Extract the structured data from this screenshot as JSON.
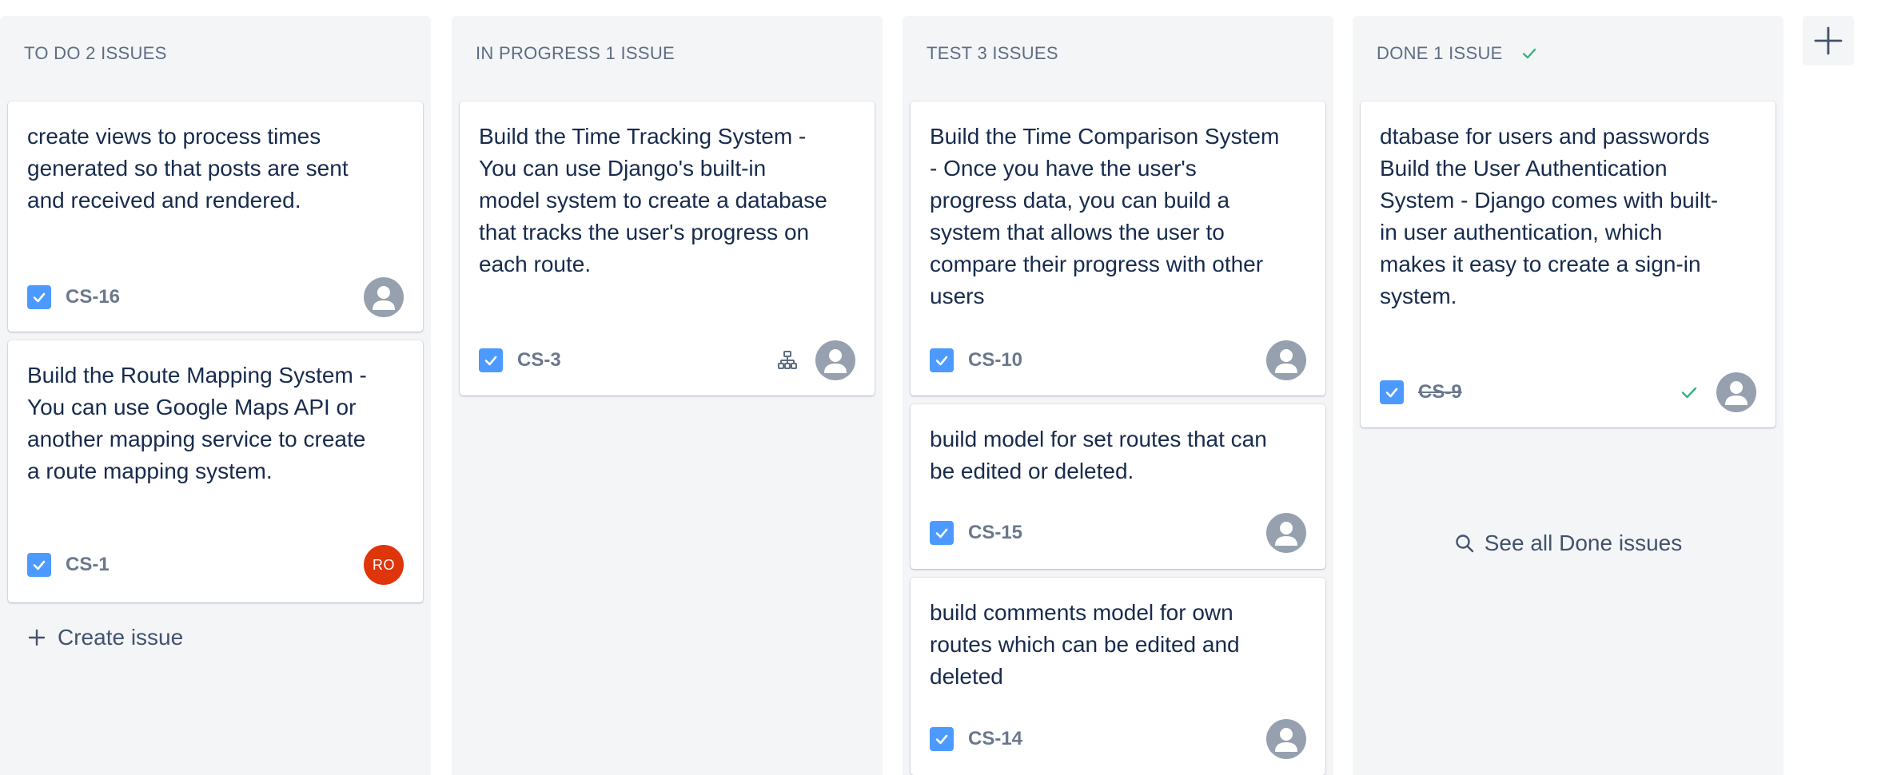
{
  "columns": [
    {
      "title": "TO DO 2 ISSUES",
      "cards": [
        {
          "title": "create views to process times generated so that posts are sent and received and rendered.",
          "key": "CS-16"
        },
        {
          "title": "Build the Route Mapping System - You can use Google Maps API or another mapping service to create a route mapping system.",
          "key": "CS-1",
          "assignee_initials": "RO"
        }
      ],
      "create_label": "Create issue"
    },
    {
      "title": "IN PROGRESS 1 ISSUE",
      "cards": [
        {
          "title": "Build the Time Tracking System - You can use Django's built-in model system to create a database that tracks the user's progress on each route.",
          "key": "CS-3"
        }
      ]
    },
    {
      "title": "TEST 3 ISSUES",
      "cards": [
        {
          "title": "Build the Time Comparison System - Once you have the user's progress data, you can build a system that allows the user to compare their progress with other users",
          "key": "CS-10"
        },
        {
          "title": "build model for set routes that can be edited or deleted.",
          "key": "CS-15"
        },
        {
          "title": "build comments model for own routes which can be edited and deleted",
          "key": "CS-14"
        }
      ]
    },
    {
      "title": "DONE 1 ISSUE",
      "cards": [
        {
          "title": "dtabase for users and passwords Build the User Authentication System - Django comes with built-in user authentication, which makes it easy to create a sign-in system.",
          "key": "CS-9"
        }
      ],
      "see_all_label": "See all Done issues"
    }
  ],
  "icons": {
    "checkbox": "checkbox-icon",
    "avatar": "user-avatar-icon",
    "hierarchy": "child-issues-icon",
    "done": "check-icon",
    "add": "plus-icon",
    "search": "search-icon"
  },
  "colors": {
    "column_bg": "#f4f5f7",
    "checkbox": "#4c9aff",
    "done_green": "#36b37e",
    "avatar_grey": "#97a0af",
    "avatar_ro": "#de350b"
  }
}
